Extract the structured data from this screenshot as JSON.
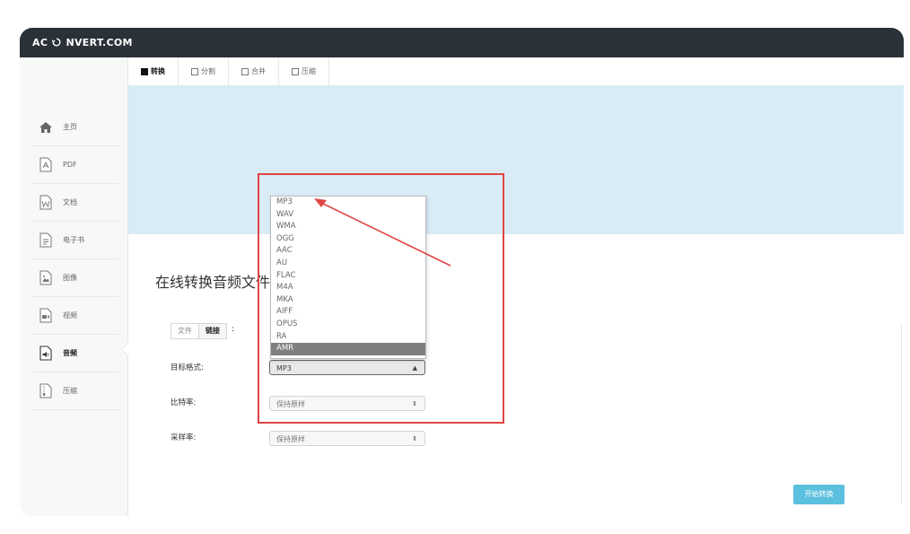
{
  "brand": {
    "logo_prefix": "AC",
    "logo_suffix": "NVERT.COM"
  },
  "sidebar": {
    "items": [
      {
        "label": "主页",
        "icon": "home-icon"
      },
      {
        "label": "PDF",
        "icon": "pdf-file-icon"
      },
      {
        "label": "文档",
        "icon": "word-document-icon"
      },
      {
        "label": "电子书",
        "icon": "ebook-icon"
      },
      {
        "label": "图像",
        "icon": "image-file-icon"
      },
      {
        "label": "视频",
        "icon": "video-file-icon"
      },
      {
        "label": "音频",
        "icon": "audio-file-icon",
        "active": true
      },
      {
        "label": "压缩",
        "icon": "archive-file-icon"
      }
    ]
  },
  "tabs": [
    {
      "label": "转换",
      "active": true
    },
    {
      "label": "分割"
    },
    {
      "label": "合并"
    },
    {
      "label": "压缩"
    }
  ],
  "main": {
    "heading": "在线转换音频文件",
    "source": {
      "file_label": "文件",
      "link_label": "链接",
      "colon": ":"
    },
    "format": {
      "label": "目标格式:",
      "value": "MP3"
    },
    "bitrate": {
      "label": "比特率:",
      "value": "保持原样"
    },
    "samplerate": {
      "label": "采样率:",
      "value": "保持原样"
    },
    "start_button": "开始转换"
  },
  "dropdown": {
    "options": [
      "MP3",
      "WAV",
      "WMA",
      "OGG",
      "AAC",
      "AU",
      "FLAC",
      "M4A",
      "MKA",
      "AIFF",
      "OPUS",
      "RA",
      "AMR"
    ],
    "highlighted": "AMR"
  },
  "colors": {
    "topbar": "#2b3138",
    "banner": "#d9ebf5",
    "annotation": "#e04545",
    "button": "#5bc0de"
  }
}
